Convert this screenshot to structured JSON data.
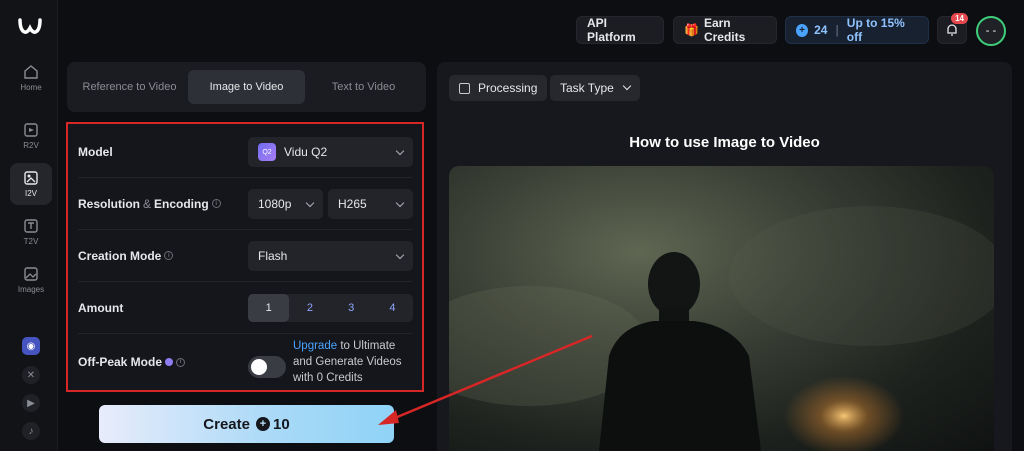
{
  "sidebar": {
    "items": [
      {
        "label": "Home",
        "icon": "home-icon"
      },
      {
        "label": "R2V",
        "icon": "r2v-icon"
      },
      {
        "label": "I2V",
        "icon": "i2v-icon"
      },
      {
        "label": "T2V",
        "icon": "t2v-icon"
      },
      {
        "label": "Images",
        "icon": "images-icon"
      }
    ],
    "social": [
      "discord-icon",
      "x-icon",
      "youtube-icon",
      "tiktok-icon"
    ]
  },
  "topbar": {
    "api_platform": "API Platform",
    "earn_credits": "Earn Credits",
    "credits": "24",
    "discount": "Up to 15% off",
    "notification_count": "14",
    "avatar": "- -"
  },
  "tabs": [
    "Reference to Video",
    "Image to Video",
    "Text to Video"
  ],
  "settings": {
    "model_label": "Model",
    "model_value": "Vidu Q2",
    "model_badge": "Q2",
    "resolution_label_a": "Resolution",
    "resolution_label_amp": "&",
    "resolution_label_b": "Encoding",
    "resolution_value": "1080p",
    "encoding_value": "H265",
    "creation_label": "Creation Mode",
    "creation_value": "Flash",
    "amount_label": "Amount",
    "amounts": [
      "1",
      "2",
      "3",
      "4"
    ],
    "offpeak_label": "Off-Peak Mode",
    "upgrade_link": "Upgrade",
    "upgrade_text": " to Ultimate and Generate Videos with 0 Credits"
  },
  "create": {
    "label": "Create",
    "cost": "10"
  },
  "right": {
    "processing": "Processing",
    "task_type": "Task Type",
    "howto_title": "How to use Image to Video"
  },
  "colors": {
    "annotation": "#d72626",
    "accent": "#4aa3ff"
  }
}
